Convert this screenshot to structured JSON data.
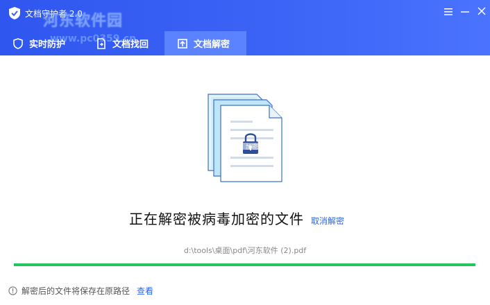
{
  "window": {
    "title": "文档守护者 2.0",
    "watermark": "河东软件园",
    "watermark_url": "www.pc0359.cn"
  },
  "tabs": [
    {
      "label": "实时防护",
      "icon": "shield-icon"
    },
    {
      "label": "文档找回",
      "icon": "document-restore-icon"
    },
    {
      "label": "文档解密",
      "icon": "unlock-upload-icon",
      "active": true
    }
  ],
  "illustration": {
    "badge_text": "加密"
  },
  "status": {
    "message": "正在解密被病毒加密的文件",
    "cancel_label": "取消解密",
    "file_path": "d:\\tools\\桌面\\pdf\\河东软件 (2).pdf",
    "progress": 1.0
  },
  "footer": {
    "note": "解密后的文件将保存在原路径",
    "view_label": "查看"
  },
  "colors": {
    "header_blue": "#3b63f5",
    "active_tab": "#5b83ff",
    "progress_green": "#22c55e",
    "link_blue": "#2e67e8"
  }
}
